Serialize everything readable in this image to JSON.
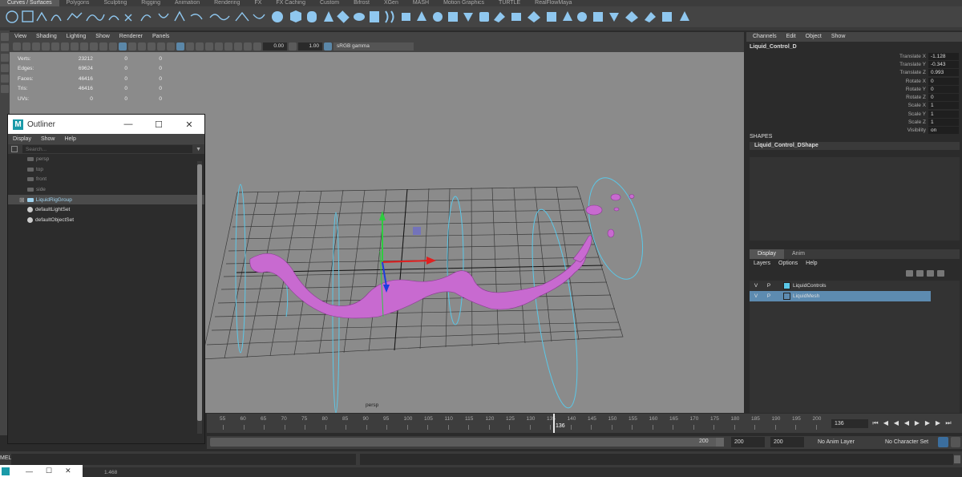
{
  "shelf": {
    "tabs": [
      "Curves / Surfaces",
      "Polygons",
      "Sculpting",
      "Rigging",
      "Animation",
      "Rendering",
      "FX",
      "FX Caching",
      "Custom",
      "Bifrost",
      "XGen",
      "MASH",
      "Motion Graphics",
      "TURTLE",
      "RealFlowMaya"
    ],
    "active_tab": "Curves / Surfaces"
  },
  "viewport": {
    "menu": [
      "View",
      "Shading",
      "Lighting",
      "Show",
      "Renderer",
      "Panels"
    ],
    "exposure": "0.00",
    "gamma": "1.00",
    "color_space": "sRGB gamma",
    "camera_label": "persp",
    "hud": [
      {
        "label": "Verts:",
        "v1": "23212",
        "v2": "0",
        "v3": "0"
      },
      {
        "label": "Edges:",
        "v1": "69624",
        "v2": "0",
        "v3": "0"
      },
      {
        "label": "Faces:",
        "v1": "46416",
        "v2": "0",
        "v3": "0"
      },
      {
        "label": "Tris:",
        "v1": "46416",
        "v2": "0",
        "v3": "0"
      },
      {
        "label": "UVs:",
        "v1": "0",
        "v2": "0",
        "v3": "0"
      }
    ]
  },
  "outliner": {
    "title": "Outliner",
    "menu": [
      "Display",
      "Show",
      "Help"
    ],
    "search_placeholder": "Search...",
    "items": [
      {
        "label": "persp",
        "icon": "camera-icon"
      },
      {
        "label": "top",
        "icon": "camera-icon"
      },
      {
        "label": "front",
        "icon": "camera-icon"
      },
      {
        "label": "side",
        "icon": "camera-icon"
      },
      {
        "label": "LiquidRigGroup",
        "icon": "group-icon",
        "selected": true
      },
      {
        "label": "defaultLightSet",
        "icon": "set-icon"
      },
      {
        "label": "defaultObjectSet",
        "icon": "set-icon"
      }
    ]
  },
  "channel_box": {
    "menu": [
      "Channels",
      "Edit",
      "Object",
      "Show"
    ],
    "object_name": "Liquid_Control_D",
    "channels": [
      {
        "label": "Translate X",
        "value": "-1.128"
      },
      {
        "label": "Translate Y",
        "value": "-0.343"
      },
      {
        "label": "Translate Z",
        "value": "0.993"
      },
      {
        "label": "Rotate X",
        "value": "0"
      },
      {
        "label": "Rotate Y",
        "value": "0"
      },
      {
        "label": "Rotate Z",
        "value": "0"
      },
      {
        "label": "Scale X",
        "value": "1"
      },
      {
        "label": "Scale Y",
        "value": "1"
      },
      {
        "label": "Scale Z",
        "value": "1"
      },
      {
        "label": "Visibility",
        "value": "on"
      }
    ],
    "shapes_header": "SHAPES",
    "shape_name": "Liquid_Control_DShape"
  },
  "layers": {
    "tabs": [
      "Display",
      "Anim"
    ],
    "active_tab": "Display",
    "menu": [
      "Layers",
      "Options",
      "Help"
    ],
    "items": [
      {
        "v": "V",
        "p": "P",
        "name": "LiquidControls",
        "color": "#5bc8e8",
        "selected": false
      },
      {
        "v": "V",
        "p": "P",
        "name": "LiquidMesh",
        "color": "#5d8bb0",
        "selected": true
      }
    ]
  },
  "timeline": {
    "ticks": [
      "55",
      "60",
      "65",
      "70",
      "75",
      "80",
      "85",
      "90",
      "95",
      "100",
      "105",
      "110",
      "115",
      "120",
      "125",
      "130",
      "135",
      "140",
      "145",
      "150",
      "155",
      "160",
      "165",
      "170",
      "175",
      "180",
      "185",
      "190",
      "195",
      "200"
    ],
    "current_frame": "136",
    "range_end": "200",
    "start_field": "200",
    "end_field": "200",
    "anim_layer": "No Anim Layer",
    "character_set": "No Character Set"
  },
  "command_line": {
    "label": "MEL",
    "status_value": "1.468"
  },
  "colors": {
    "viewport_bg": "#8b8b8b",
    "liquid_mesh": "#c86ad0",
    "selection_blue": "#5d8bb0",
    "control_curve": "#5bc8e8"
  }
}
